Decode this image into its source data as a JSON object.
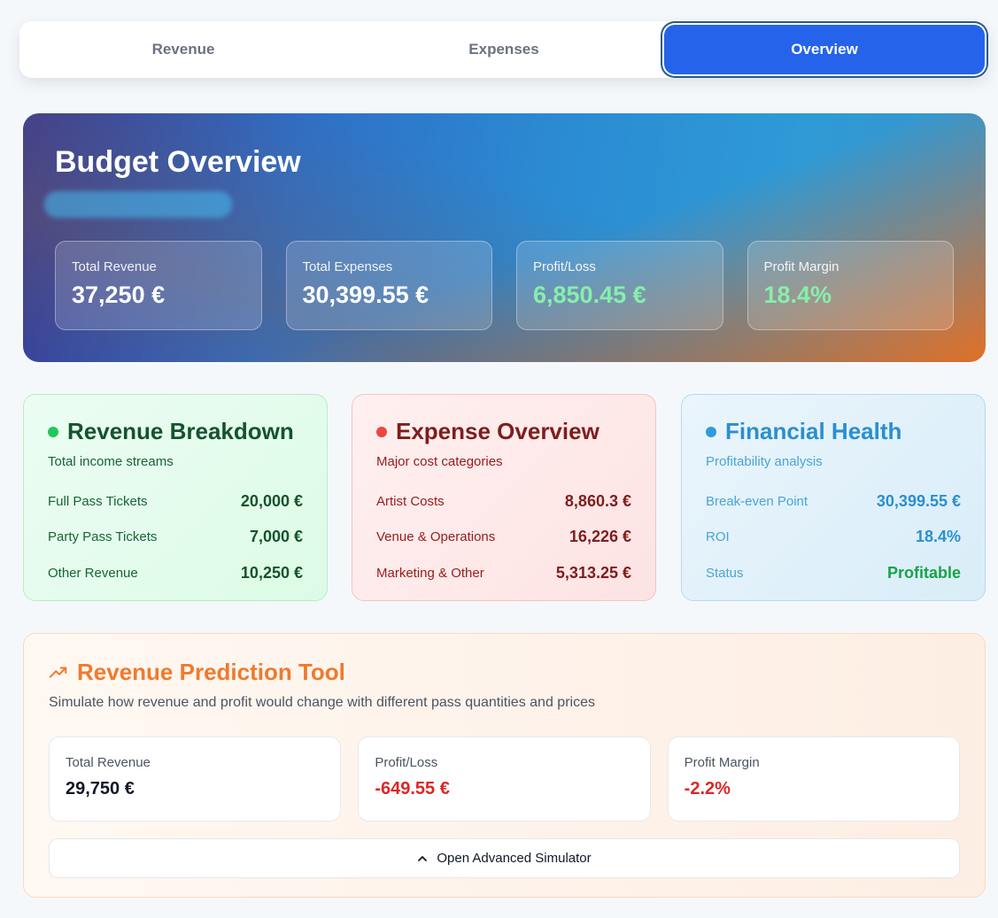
{
  "tabs": [
    {
      "label": "Revenue"
    },
    {
      "label": "Expenses"
    },
    {
      "label": "Overview"
    }
  ],
  "hero": {
    "title": "Budget Overview",
    "stats": [
      {
        "label": "Total Revenue",
        "value": "37,250 €"
      },
      {
        "label": "Total Expenses",
        "value": "30,399.55 €"
      },
      {
        "label": "Profit/Loss",
        "value": "6,850.45 €"
      },
      {
        "label": "Profit Margin",
        "value": "18.4%"
      }
    ]
  },
  "revenue_breakdown": {
    "title": "Revenue Breakdown",
    "subtitle": "Total income streams",
    "rows": [
      {
        "label": "Full Pass Tickets",
        "value": "20,000 €"
      },
      {
        "label": "Party Pass Tickets",
        "value": "7,000 €"
      },
      {
        "label": "Other Revenue",
        "value": "10,250 €"
      }
    ]
  },
  "expense_overview": {
    "title": "Expense Overview",
    "subtitle": "Major cost categories",
    "rows": [
      {
        "label": "Artist Costs",
        "value": "8,860.3 €"
      },
      {
        "label": "Venue & Operations",
        "value": "16,226 €"
      },
      {
        "label": "Marketing & Other",
        "value": "5,313.25 €"
      }
    ]
  },
  "financial_health": {
    "title": "Financial Health",
    "subtitle": "Profitability analysis",
    "rows": [
      {
        "label": "Break-even Point",
        "value": "30,399.55 €"
      },
      {
        "label": "ROI",
        "value": "18.4%"
      },
      {
        "label": "Status",
        "value": "Profitable"
      }
    ]
  },
  "prediction": {
    "title": "Revenue Prediction Tool",
    "subtitle": "Simulate how revenue and profit would change with different pass quantities and prices",
    "stats": [
      {
        "label": "Total Revenue",
        "value": "29,750 €"
      },
      {
        "label": "Profit/Loss",
        "value": "-649.55 €"
      },
      {
        "label": "Profit Margin",
        "value": "-2.2%"
      }
    ],
    "button_label": "Open Advanced Simulator"
  },
  "colors": {
    "accent": "#2563eb",
    "positive": "#86efac",
    "negative": "#dc2626",
    "prediction_accent": "#f07a2c"
  },
  "icons": [
    "trending-up-icon",
    "chevron-up-icon"
  ]
}
